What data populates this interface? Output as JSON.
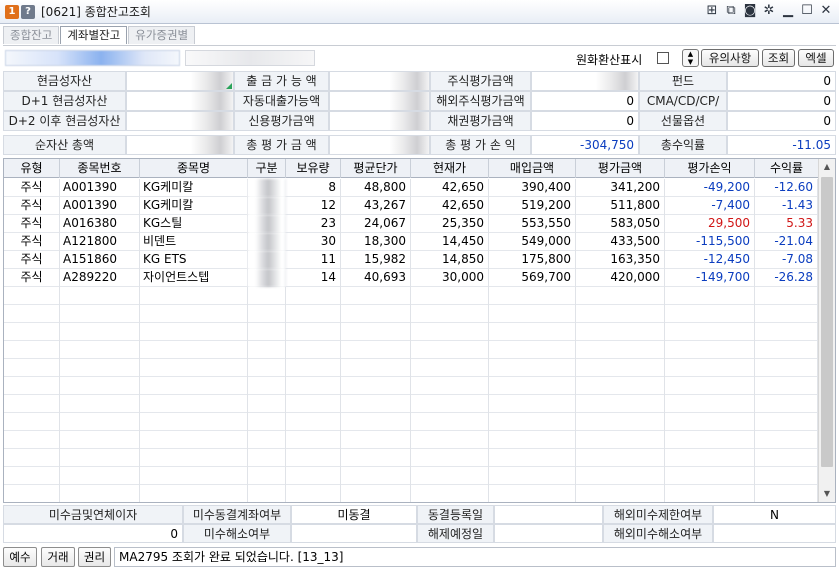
{
  "window": {
    "badge_one": "1",
    "badge_q": "?",
    "title": "[0621] 종합잔고조회",
    "icons": [
      "grid-icon",
      "copy-icon",
      "camera-icon",
      "gear-icon",
      "minimize-icon",
      "maximize-icon",
      "close-icon"
    ]
  },
  "tabs": [
    {
      "label": "종합잔고",
      "active": false
    },
    {
      "label": "계좌별잔고",
      "active": true
    },
    {
      "label": "유가증권별",
      "active": false
    }
  ],
  "toolbar": {
    "fx_label": "원화환산표시",
    "notice_button": "유의사항",
    "query_button": "조회",
    "excel_button": "엑셀"
  },
  "summary": {
    "row1": {
      "cash_assets": "현금성자산",
      "withdrawable": "출 금 가 능 액",
      "stock_eval": "주식평가금액",
      "fund": "펀드",
      "fund_value": "0"
    },
    "row2": {
      "d1_cash": "D+1 현금성자산",
      "auto_loan": "자동대출가능액",
      "overseas_eval": "해외주식평가금액",
      "overseas_value": "0",
      "cma": "CMA/CD/CP/",
      "cma_value": "0"
    },
    "row3": {
      "d2_cash": "D+2 이후 현금성자산",
      "credit_eval": "신용평가금액",
      "bond_eval": "채권평가금액",
      "bond_value": "0",
      "futures": "선물옵션",
      "futures_value": "0"
    },
    "row4": {
      "net_assets": "순자산 총액",
      "total_eval": "총 평 가 금 액",
      "total_pl": "총 평 가 손 익",
      "total_pl_value": "-304,750",
      "total_return": "총수익률",
      "total_return_value": "-11.05"
    }
  },
  "table": {
    "headers": [
      "유형",
      "종목번호",
      "종목명",
      "구분",
      "보유량",
      "평균단가",
      "현재가",
      "매입금액",
      "평가금액",
      "평가손익",
      "수익률"
    ],
    "rows": [
      {
        "type": "주식",
        "code": "A001390",
        "name": "KG케미칼",
        "qty": "8",
        "avg": "48,800",
        "cur": "42,650",
        "buy": "390,400",
        "eval": "341,200",
        "pl": "-49,200",
        "ret": "-12.60",
        "sign": "neg"
      },
      {
        "type": "주식",
        "code": "A001390",
        "name": "KG케미칼",
        "qty": "12",
        "avg": "43,267",
        "cur": "42,650",
        "buy": "519,200",
        "eval": "511,800",
        "pl": "-7,400",
        "ret": "-1.43",
        "sign": "neg"
      },
      {
        "type": "주식",
        "code": "A016380",
        "name": "KG스틸",
        "qty": "23",
        "avg": "24,067",
        "cur": "25,350",
        "buy": "553,550",
        "eval": "583,050",
        "pl": "29,500",
        "ret": "5.33",
        "sign": "pos"
      },
      {
        "type": "주식",
        "code": "A121800",
        "name": "비덴트",
        "qty": "30",
        "avg": "18,300",
        "cur": "14,450",
        "buy": "549,000",
        "eval": "433,500",
        "pl": "-115,500",
        "ret": "-21.04",
        "sign": "neg"
      },
      {
        "type": "주식",
        "code": "A151860",
        "name": "KG ETS",
        "qty": "11",
        "avg": "15,982",
        "cur": "14,850",
        "buy": "175,800",
        "eval": "163,350",
        "pl": "-12,450",
        "ret": "-7.08",
        "sign": "neg"
      },
      {
        "type": "주식",
        "code": "A289220",
        "name": "자이언트스텝",
        "qty": "14",
        "avg": "40,693",
        "cur": "30,000",
        "buy": "569,700",
        "eval": "420,000",
        "pl": "-149,700",
        "ret": "-26.28",
        "sign": "neg"
      }
    ]
  },
  "bottom": {
    "unpaid_interest": "미수금및연체이자",
    "unpaid_interest_value": "0",
    "frozen_acct": "미수동결계좌여부",
    "frozen_value": "미동결",
    "freeze_date": "동결등록일",
    "overseas_limit": "해외미수제한여부",
    "overseas_limit_value": "N",
    "unpaid_cancel": "미수해소여부",
    "release_date": "해제예정일",
    "overseas_cancel": "해외미수해소여부"
  },
  "status": {
    "btn_deposit": "예수",
    "btn_trade": "거래",
    "btn_rights": "권리",
    "message": "MA2795 조회가 완료 되었습니다. [13_13]"
  },
  "colors": {
    "negative": "#0b3dbf",
    "positive": "#d01616",
    "accent_orange": "#e0701b"
  }
}
